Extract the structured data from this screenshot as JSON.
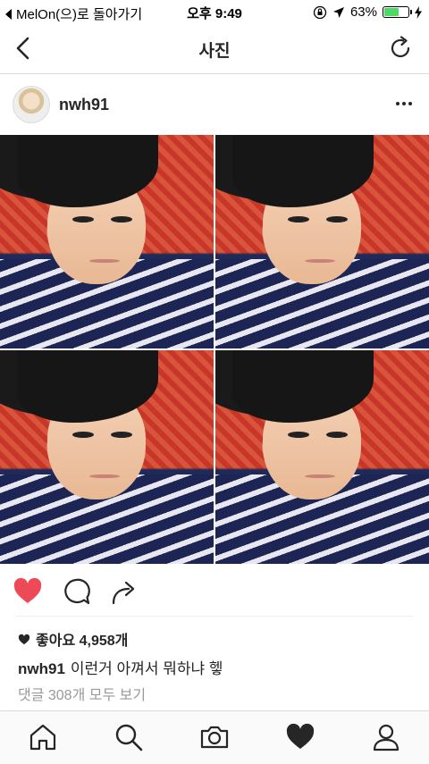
{
  "status": {
    "back_app": "MelOn(으)로 돌아가기",
    "time": "오후 9:49",
    "battery": "63%",
    "battery_level": 0.63
  },
  "nav": {
    "title": "사진"
  },
  "post": {
    "username": "nwh91",
    "liked": true,
    "likes_text": "좋아요 4,958개",
    "caption_user": "nwh91",
    "caption_text": "이런거 아껴서 뭐하냐 헿",
    "comments_link": "댓글 308개 모두 보기"
  },
  "colors": {
    "like_red": "#ed4956",
    "battery_green": "#4cd964",
    "muted_text": "#999999"
  },
  "icons": {
    "actions": [
      "heart-icon",
      "comment-icon",
      "share-icon"
    ],
    "tabs": [
      "home-icon",
      "search-icon",
      "camera-icon",
      "heart-icon",
      "profile-icon"
    ],
    "active_tab": "heart-icon"
  }
}
